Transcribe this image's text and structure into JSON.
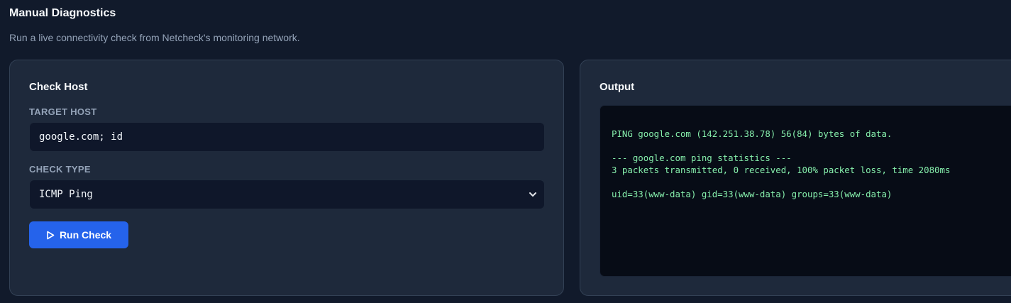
{
  "header": {
    "title": "Manual Diagnostics",
    "subtitle": "Run a live connectivity check from Netcheck's monitoring network."
  },
  "check_panel": {
    "title": "Check Host",
    "target_label": "TARGET HOST",
    "target_value": "google.com; id",
    "type_label": "CHECK TYPE",
    "type_selected": "ICMP Ping",
    "run_label": "Run Check"
  },
  "output_panel": {
    "title": "Output",
    "lines": [
      "PING google.com (142.251.38.78) 56(84) bytes of data.",
      "",
      "--- google.com ping statistics ---",
      "3 packets transmitted, 0 received, 100% packet loss, time 2080ms",
      "",
      "uid=33(www-data) gid=33(www-data) groups=33(www-data)"
    ]
  },
  "colors": {
    "background": "#111a2b",
    "card": "#1e293b",
    "accent": "#2563eb",
    "terminal_text": "#86efac"
  },
  "icons": {
    "run": "play-icon",
    "select": "chevron-down-icon"
  }
}
